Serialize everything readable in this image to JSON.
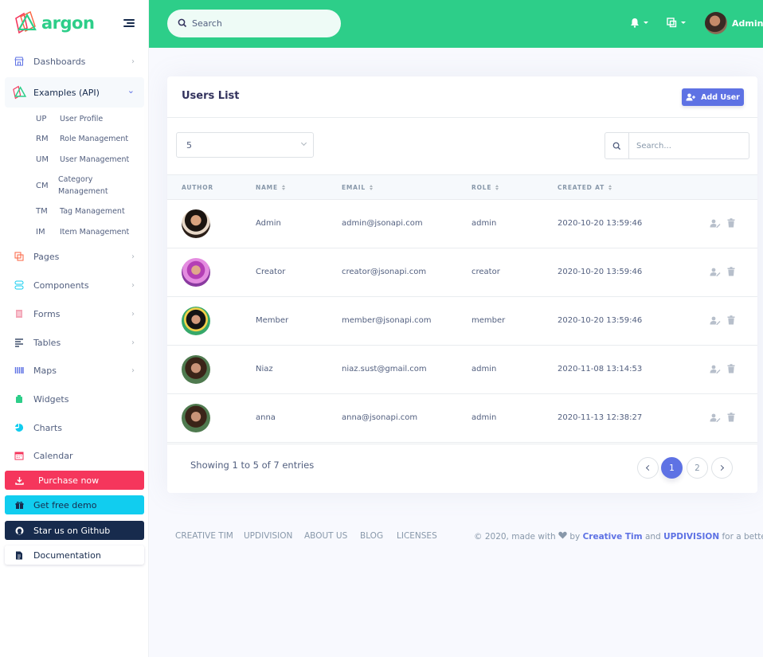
{
  "brand": {
    "name": "argon"
  },
  "sidebar": {
    "items": [
      {
        "label": "Dashboards",
        "icon": "shop-icon",
        "chevron": "›"
      },
      {
        "label": "Examples (API)",
        "icon": "laravel-logo-icon",
        "chevron": "⌄"
      },
      {
        "label": "Pages",
        "icon": "pages-icon",
        "chevron": "›"
      },
      {
        "label": "Components",
        "icon": "ui-components-icon",
        "chevron": "›"
      },
      {
        "label": "Forms",
        "icon": "forms-icon",
        "chevron": "›"
      },
      {
        "label": "Tables",
        "icon": "tables-icon",
        "chevron": "›"
      },
      {
        "label": "Maps",
        "icon": "maps-icon",
        "chevron": "›"
      },
      {
        "label": "Widgets",
        "icon": "widgets-icon"
      },
      {
        "label": "Charts",
        "icon": "charts-icon"
      },
      {
        "label": "Calendar",
        "icon": "calendar-icon"
      }
    ],
    "subitems": [
      {
        "abbr": "UP",
        "label": "User Profile"
      },
      {
        "abbr": "RM",
        "label": "Role Management"
      },
      {
        "abbr": "UM",
        "label": "User Management"
      },
      {
        "abbr": "CM",
        "label": "Category Management"
      },
      {
        "abbr": "TM",
        "label": "Tag Management"
      },
      {
        "abbr": "IM",
        "label": "Item Management"
      }
    ],
    "buttons": [
      {
        "label": "Purchase now",
        "icon": "download-icon"
      },
      {
        "label": "Get free demo",
        "icon": "gift-icon"
      },
      {
        "label": "Star us on Github",
        "icon": "github-icon"
      },
      {
        "label": "Documentation",
        "icon": "document-icon"
      }
    ]
  },
  "topbar": {
    "search_placeholder": "Search",
    "user_name": "Admin"
  },
  "card": {
    "title": "Users List",
    "add_button": "Add User",
    "per_page": "5",
    "table_search_placeholder": "Search...",
    "columns": [
      "AUTHOR",
      "NAME",
      "EMAIL",
      "ROLE",
      "CREATED AT"
    ],
    "rows": [
      {
        "name": "Admin",
        "email": "admin@jsonapi.com",
        "role": "admin",
        "created_at": "2020-10-20 13:59:46"
      },
      {
        "name": "Creator",
        "email": "creator@jsonapi.com",
        "role": "creator",
        "created_at": "2020-10-20 13:59:46"
      },
      {
        "name": "Member",
        "email": "member@jsonapi.com",
        "role": "member",
        "created_at": "2020-10-20 13:59:46"
      },
      {
        "name": "Niaz",
        "email": "niaz.sust@gmail.com",
        "role": "admin",
        "created_at": "2020-11-08 13:14:53"
      },
      {
        "name": "anna",
        "email": "anna@jsonapi.com",
        "role": "admin",
        "created_at": "2020-11-13 12:38:27"
      }
    ],
    "showing": "Showing 1 to 5 of 7 entries",
    "pages": [
      "1",
      "2"
    ],
    "current_page": "1"
  },
  "footer": {
    "links": [
      "CREATIVE TIM",
      "UPDIVISION",
      "ABOUT US",
      "BLOG",
      "LICENSES"
    ],
    "copy_prefix": "© 2020, made with",
    "copy_by": "by",
    "creative_tim": "Creative Tim",
    "and": "and",
    "updivision": "UPDIVISION",
    "copy_suffix": "for a better web."
  },
  "colors": {
    "primary": "#5e72e4",
    "success": "#2dce89",
    "danger": "#f5365c",
    "info": "#11cdef",
    "dark": "#172b4d"
  }
}
